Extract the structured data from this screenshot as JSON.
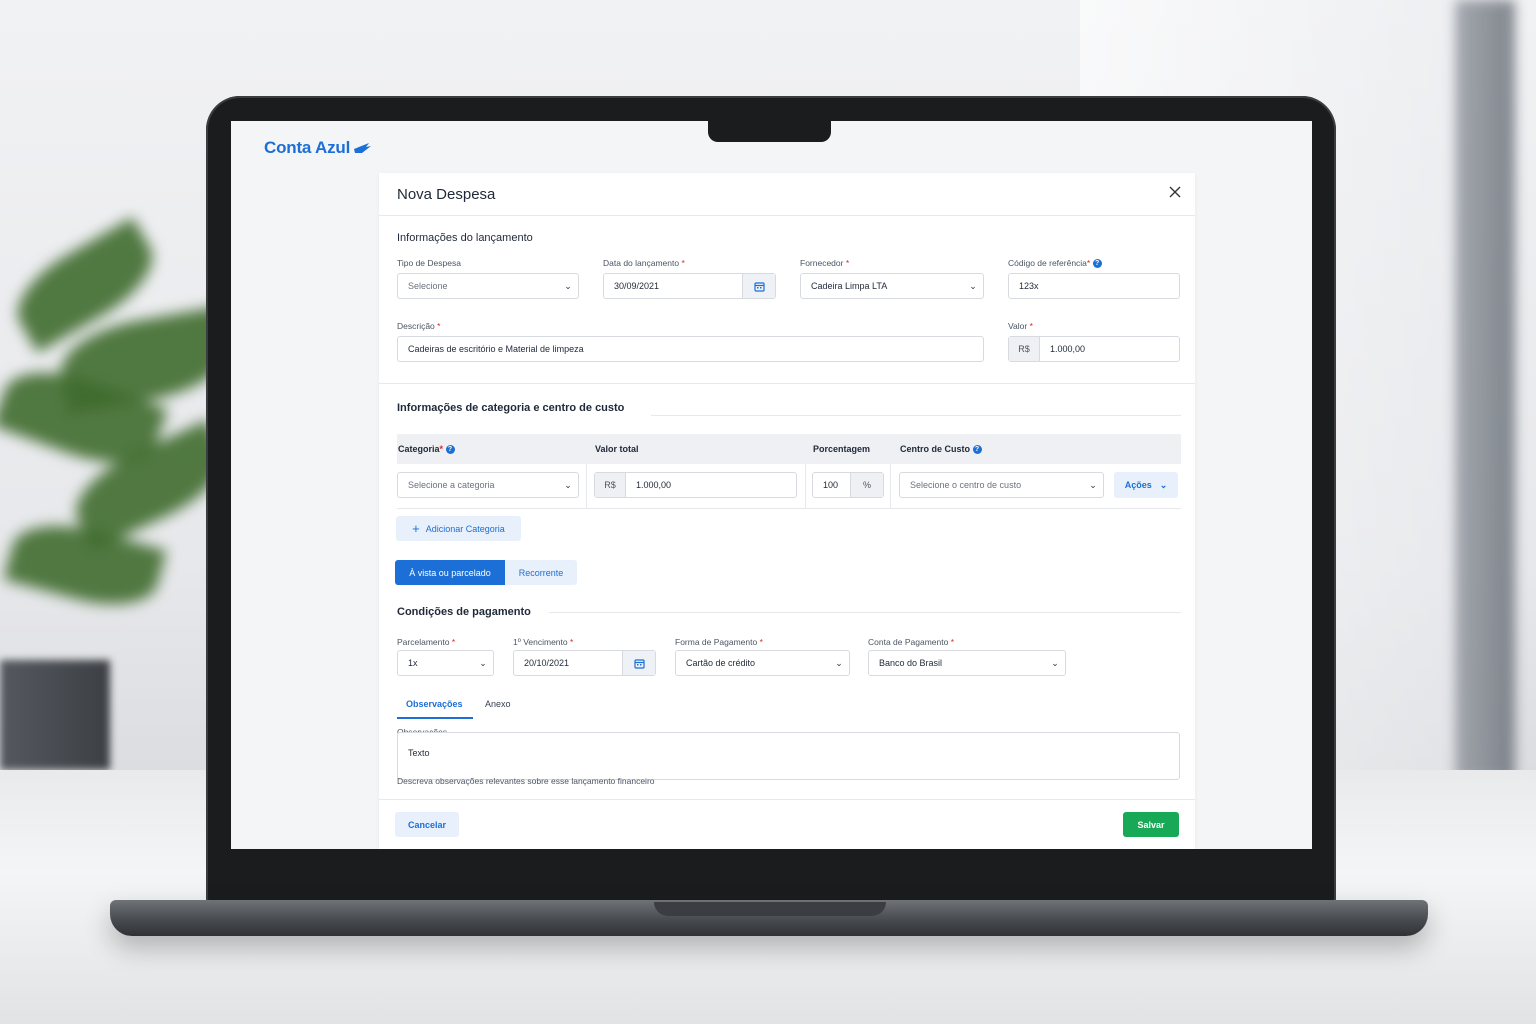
{
  "brand": {
    "name": "Conta Azul",
    "accent": "#1c6fd6",
    "success": "#18a957"
  },
  "modal": {
    "title": "Nova Despesa",
    "close_icon": "close-icon"
  },
  "section1": {
    "title": "Informações do lançamento",
    "tipo_label": "Tipo de Despesa",
    "tipo_placeholder": "Selecione",
    "data_label": "Data do lançamento",
    "data_value": "30/09/2021",
    "fornecedor_label": "Fornecedor",
    "fornecedor_value": "Cadeira Limpa LTA",
    "codigo_label": "Código de referência",
    "codigo_value": "123x",
    "descricao_label": "Descrição",
    "descricao_value": "Cadeiras de escritório e Material de limpeza",
    "valor_label": "Valor",
    "valor_prefix": "R$",
    "valor_value": "1.000,00",
    "required_mark": "*"
  },
  "section2": {
    "title": "Informações de categoria e centro de custo",
    "columns": [
      "Categoria",
      "Valor total",
      "Porcentagem",
      "Centro de Custo"
    ],
    "row": {
      "categoria_placeholder": "Selecione a categoria",
      "valor_prefix": "R$",
      "valor_value": "1.000,00",
      "porcentagem_value": "100",
      "porcentagem_suffix": "%",
      "centro_placeholder": "Selecione o centro de custo",
      "acoes_label": "Ações"
    },
    "add_label": "Adicionar Categoria"
  },
  "payment_type": {
    "options": [
      "À vista ou parcelado",
      "Recorrente"
    ],
    "selected": "À vista ou parcelado"
  },
  "section3": {
    "title": "Condições de pagamento",
    "parcelamento_label": "Parcelamento",
    "parcelamento_value": "1x",
    "vencimento_label": "1º Vencimento",
    "vencimento_value": "20/10/2021",
    "forma_label": "Forma de Pagamento",
    "forma_value": "Cartão de crédito",
    "conta_label": "Conta de Pagamento",
    "conta_value": "Banco do Brasil"
  },
  "tabs": {
    "items": [
      "Observações",
      "Anexo"
    ],
    "active": "Observações"
  },
  "observacoes": {
    "label": "Observações",
    "value": "Texto",
    "hint": "Descreva observações relevantes sobre esse lançamento financeiro"
  },
  "footer": {
    "cancel_label": "Cancelar",
    "save_label": "Salvar"
  }
}
